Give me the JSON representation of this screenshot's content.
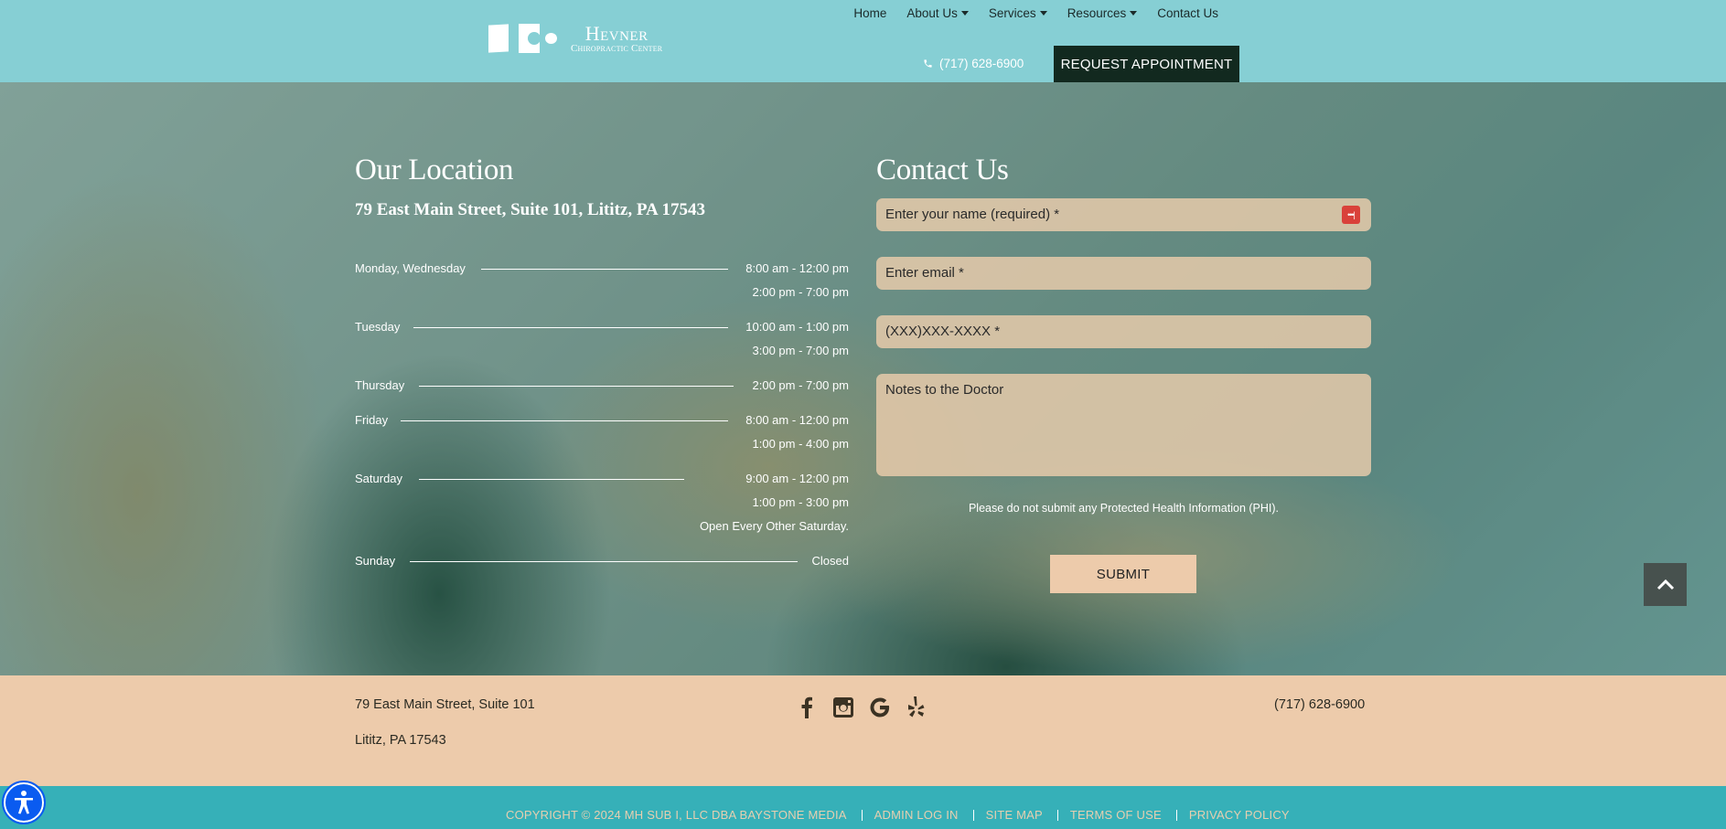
{
  "header": {
    "logo": {
      "name_line1": "Hevner",
      "name_line2": "Chiropractic Center"
    },
    "nav": [
      {
        "label": "Home",
        "dropdown": false
      },
      {
        "label": "About Us",
        "dropdown": true
      },
      {
        "label": "Services",
        "dropdown": true
      },
      {
        "label": "Resources",
        "dropdown": true
      },
      {
        "label": "Contact Us",
        "dropdown": false
      }
    ],
    "phone": "(717) 628-6900",
    "cta_label": "REQUEST APPOINTMENT"
  },
  "location": {
    "title": "Our Location",
    "address": "79 East Main Street, Suite 101, Lititz, PA 17543",
    "hours": [
      {
        "day": "Monday, Wednesday",
        "times": [
          "8:00 am - 12:00 pm",
          "2:00 pm - 7:00 pm"
        ]
      },
      {
        "day": "Tuesday",
        "times": [
          "10:00 am - 1:00 pm",
          "3:00 pm - 7:00 pm"
        ]
      },
      {
        "day": "Thursday",
        "times": [
          "2:00 pm - 7:00 pm"
        ]
      },
      {
        "day": "Friday",
        "times": [
          "8:00 am - 12:00 pm",
          "1:00 pm - 4:00 pm"
        ]
      },
      {
        "day": "Saturday",
        "times": [
          "9:00 am - 12:00 pm",
          "1:00 pm - 3:00 pm",
          "Open Every Other Saturday."
        ]
      },
      {
        "day": "Sunday",
        "times": [
          "Closed"
        ]
      }
    ]
  },
  "contact": {
    "title": "Contact Us",
    "fields": {
      "name_placeholder": "Enter your name (required) *",
      "email_placeholder": "Enter email *",
      "phone_placeholder": "(XXX)XXX-XXXX *",
      "notes_placeholder": "Notes to the Doctor"
    },
    "phi_notice": "Please do not submit any Protected Health Information (PHI).",
    "submit_label": "SUBMIT"
  },
  "footer": {
    "address_line1": "79 East Main Street, Suite 101",
    "address_line2": "Lititz, PA 17543",
    "phone": "(717) 628-6900",
    "social": [
      "facebook",
      "instagram",
      "google",
      "yelp"
    ],
    "copyright": "COPYRIGHT © 2024 MH SUB I, LLC DBA BAYSTONE MEDIA",
    "links": [
      "ADMIN LOG IN",
      "SITE MAP",
      "TERMS OF USE",
      "PRIVACY POLICY"
    ]
  },
  "colors": {
    "header_bg": "#86cfd4",
    "cta_bg": "#12291f",
    "peach": "#edcbab",
    "bottom_bar": "#36b0b8",
    "link_text": "#e6cfb0",
    "password_manager_icon": "#d9413a"
  }
}
